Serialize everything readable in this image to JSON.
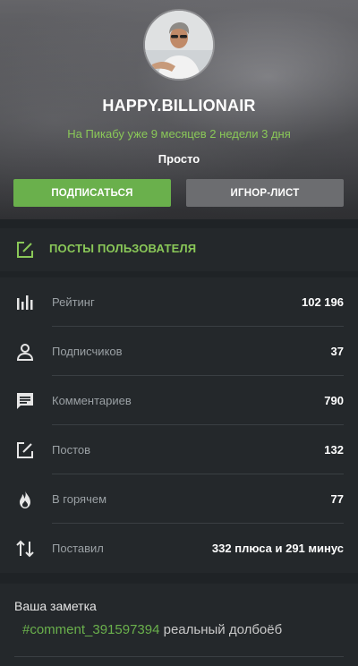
{
  "profile": {
    "username": "HAPPY.BILLIONAIR",
    "since": "На Пикабу уже 9 месяцев 2 недели 3 дня",
    "status": "Просто"
  },
  "buttons": {
    "subscribe": "ПОДПИСАТЬСЯ",
    "ignore": "ИГНОР-ЛИСТ"
  },
  "posts_link": {
    "label": "ПОСТЫ ПОЛЬЗОВАТЕЛЯ",
    "icon": "edit-icon"
  },
  "stats": [
    {
      "icon": "bar-chart-icon",
      "label": "Рейтинг",
      "value": "102 196"
    },
    {
      "icon": "person-icon",
      "label": "Подписчиков",
      "value": "37"
    },
    {
      "icon": "comment-icon",
      "label": "Комментариев",
      "value": "790"
    },
    {
      "icon": "edit-icon",
      "label": "Постов",
      "value": "132"
    },
    {
      "icon": "flame-icon",
      "label": "В горячем",
      "value": "77"
    },
    {
      "icon": "swap-vertical-icon",
      "label": "Поставил",
      "value": "332 плюса и 291 минус"
    }
  ],
  "note": {
    "title": "Ваша заметка",
    "tag": "#comment_391597394",
    "text": " реальный долбоёб"
  },
  "colors": {
    "accent_green": "#6ab04c",
    "link_green": "#8ac858",
    "background": "#1f2326",
    "panel": "#24282b"
  }
}
